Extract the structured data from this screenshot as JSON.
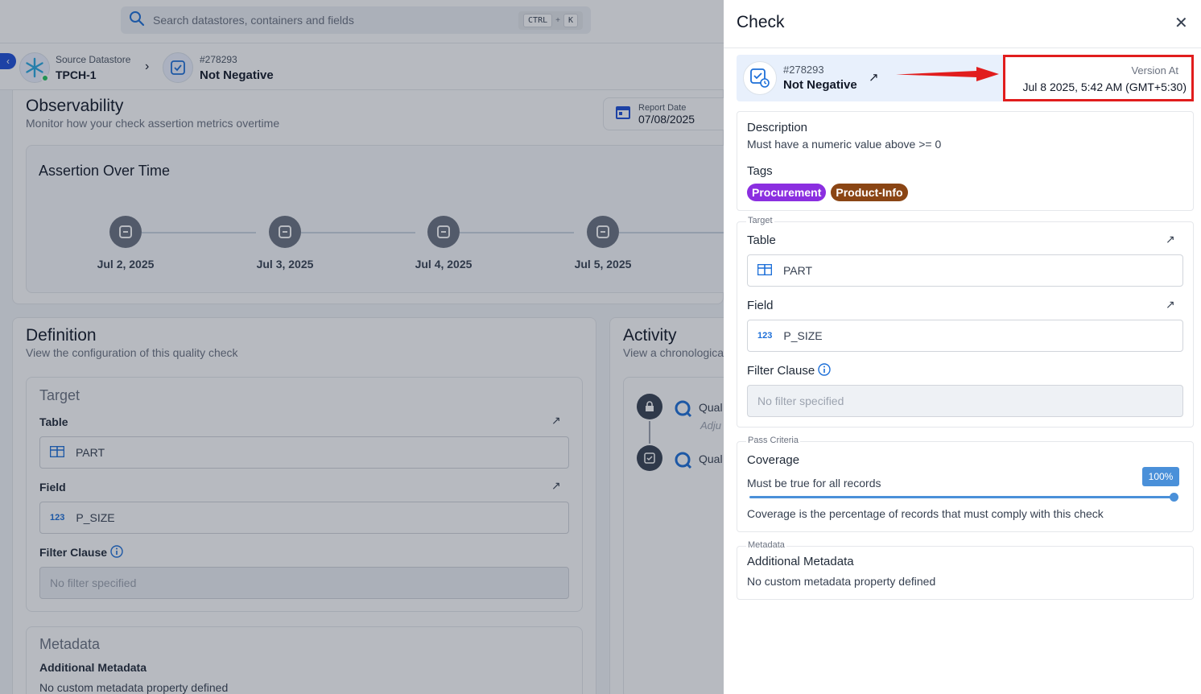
{
  "search": {
    "placeholder": "Search datastores, containers and fields",
    "shortcut_ctrl": "CTRL",
    "shortcut_plus": "+",
    "shortcut_k": "K"
  },
  "breadcrumb": {
    "datastore_label": "Source Datastore",
    "datastore_name": "TPCH-1",
    "check_id": "#278293",
    "check_name": "Not Negative"
  },
  "observability": {
    "title": "Observability",
    "subtitle": "Monitor how your check assertion metrics overtime",
    "report_date_label": "Report Date",
    "report_date_value": "07/08/2025",
    "chart_title": "Assertion Over Time",
    "timeline": [
      "Jul 2, 2025",
      "Jul 3, 2025",
      "Jul 4, 2025",
      "Jul 5, 2025"
    ]
  },
  "definition": {
    "title": "Definition",
    "subtitle": "View the configuration of this quality check",
    "target_heading": "Target",
    "table_label": "Table",
    "table_value": "PART",
    "field_label": "Field",
    "field_value": "P_SIZE",
    "field_type_badge": "123",
    "filter_label": "Filter Clause",
    "filter_placeholder": "No filter specified",
    "metadata_heading": "Metadata",
    "metadata_label": "Additional Metadata",
    "metadata_text": "No custom metadata property defined"
  },
  "activity": {
    "title": "Activity",
    "subtitle": "View a chronological",
    "items": [
      "Qual",
      "Qual"
    ],
    "item_sub": "Adju"
  },
  "drawer": {
    "title": "Check",
    "close": "✕",
    "check_id": "#278293",
    "check_name": "Not Negative",
    "version_label": "Version At",
    "version_value": "Jul 8 2025, 5:42 AM (GMT+5:30)",
    "description_label": "Description",
    "description_text": "Must have a numeric value above >= 0",
    "tags_label": "Tags",
    "tags": [
      {
        "name": "Procurement",
        "color": "#8b2fe0"
      },
      {
        "name": "Product-Info",
        "color": "#8a4514"
      }
    ],
    "target_legend": "Target",
    "table_label": "Table",
    "table_value": "PART",
    "field_label": "Field",
    "field_value": "P_SIZE",
    "field_type_badge": "123",
    "filter_label": "Filter Clause",
    "filter_placeholder": "No filter specified",
    "pass_legend": "Pass Criteria",
    "coverage_label": "Coverage",
    "coverage_text": "Must be true for all records",
    "coverage_value": 100,
    "coverage_badge": "100%",
    "coverage_help": "Coverage is the percentage of records that must comply with this check",
    "metadata_legend": "Metadata",
    "metadata_label": "Additional Metadata",
    "metadata_text": "No custom metadata property defined"
  },
  "colors": {
    "accent": "#1d6fd8",
    "highlight": "#e11d1d",
    "slider": "#4a90d9"
  }
}
